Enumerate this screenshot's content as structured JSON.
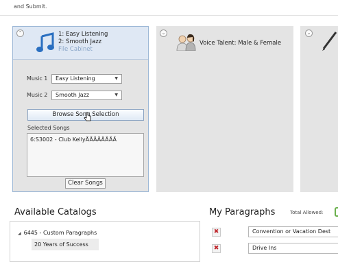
{
  "header": {
    "instruction_tail": "and Submit."
  },
  "music_panel": {
    "line1": "1: Easy Listening",
    "line2": "2: Smooth Jazz",
    "cabinet_link": "File Cabinet",
    "music1_label": "Music 1",
    "music1_value": "Easy Listening",
    "music2_label": "Music 2",
    "music2_value": "Smooth Jazz",
    "browse_button": "Browse Song Selection",
    "selected_songs_label": "Selected Songs",
    "selected_songs": [
      "6:S3002 - Club KellyÃÃÃÃÃÃÃÃ"
    ],
    "clear_button": "Clear Songs"
  },
  "voice_panel": {
    "label": "Voice Talent: Male & Female"
  },
  "catalogs": {
    "title": "Available Catalogs",
    "root": "6445 - Custom Paragraphs",
    "child": "20 Years of Success"
  },
  "paragraphs": {
    "title": "My Paragraphs",
    "total_allowed_label": "Total Allowed:",
    "items": [
      "Convention or Vacation Dest",
      "Drive Ins"
    ]
  },
  "icons": {
    "collapse": "collapse-chevron-icon",
    "music": "music-note-icon",
    "voice": "people-icon",
    "script": "pen-icon",
    "delete": "delete-x-icon"
  },
  "colors": {
    "accent_border": "#9cb7d6",
    "panel_bg": "#e4e4e4",
    "delete_red": "#c0282d",
    "total_box_green": "#6ab04c"
  }
}
